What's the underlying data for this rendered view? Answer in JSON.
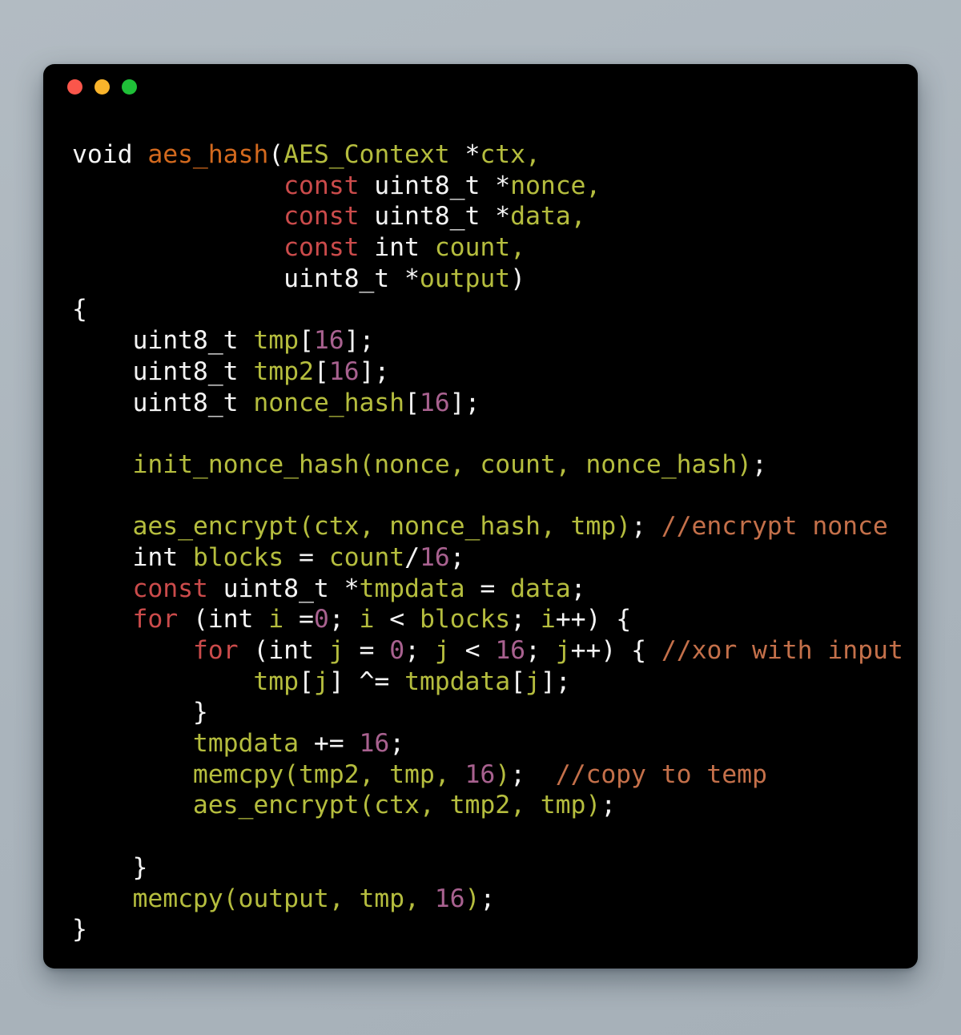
{
  "window": {
    "background_color": "#000000",
    "page_background_color": "#aeb7bf",
    "traffic_lights": [
      {
        "name": "close",
        "color": "#fa564b"
      },
      {
        "name": "minimize",
        "color": "#f9b42b"
      },
      {
        "name": "maximize",
        "color": "#1fc038"
      }
    ]
  },
  "theme": {
    "plain": "#f4f4f4",
    "keyword": "#cb4b4b",
    "function": "#d2691e",
    "identifier": "#b5bd3e",
    "number": "#a8618f",
    "comment": "#c4704a"
  },
  "code": {
    "language": "c",
    "plain_text": "void aes_hash(AES_Context *ctx,\n              const uint8_t *nonce,\n              const uint8_t *data,\n              const int count,\n              uint8_t *output)\n{\n    uint8_t tmp[16];\n    uint8_t tmp2[16];\n    uint8_t nonce_hash[16];\n\n    init_nonce_hash(nonce, count, nonce_hash);\n\n    aes_encrypt(ctx, nonce_hash, tmp); //encrypt nonce\n    int blocks = count/16;\n    const uint8_t *tmpdata = data;\n    for (int i =0; i < blocks; i++) {\n        for (int j = 0; j < 16; j++) { //xor with input\n            tmp[j] ^= tmpdata[j];\n        }\n        tmpdata += 16;\n        memcpy(tmp2, tmp, 16);  //copy to temp\n        aes_encrypt(ctx, tmp2, tmp);\n\n    }\n    memcpy(output, tmp, 16);\n}",
    "lines": [
      [
        {
          "t": "void ",
          "c": "plain"
        },
        {
          "t": "aes_hash",
          "c": "function"
        },
        {
          "t": "(",
          "c": "plain"
        },
        {
          "t": "AES_Context",
          "c": "identifier"
        },
        {
          "t": " *",
          "c": "plain"
        },
        {
          "t": "ctx",
          "c": "identifier"
        },
        {
          "t": ",",
          "c": "identifier"
        }
      ],
      [
        {
          "t": "              ",
          "c": "plain"
        },
        {
          "t": "const",
          "c": "keyword"
        },
        {
          "t": " uint8_t *",
          "c": "plain"
        },
        {
          "t": "nonce",
          "c": "identifier"
        },
        {
          "t": ",",
          "c": "identifier"
        }
      ],
      [
        {
          "t": "              ",
          "c": "plain"
        },
        {
          "t": "const",
          "c": "keyword"
        },
        {
          "t": " uint8_t *",
          "c": "plain"
        },
        {
          "t": "data",
          "c": "identifier"
        },
        {
          "t": ",",
          "c": "identifier"
        }
      ],
      [
        {
          "t": "              ",
          "c": "plain"
        },
        {
          "t": "const",
          "c": "keyword"
        },
        {
          "t": " int ",
          "c": "plain"
        },
        {
          "t": "count",
          "c": "identifier"
        },
        {
          "t": ",",
          "c": "identifier"
        }
      ],
      [
        {
          "t": "              uint8_t *",
          "c": "plain"
        },
        {
          "t": "output",
          "c": "identifier"
        },
        {
          "t": ")",
          "c": "plain"
        }
      ],
      [
        {
          "t": "{",
          "c": "plain"
        }
      ],
      [
        {
          "t": "    uint8_t ",
          "c": "plain"
        },
        {
          "t": "tmp",
          "c": "identifier"
        },
        {
          "t": "[",
          "c": "plain"
        },
        {
          "t": "16",
          "c": "number"
        },
        {
          "t": "];",
          "c": "plain"
        }
      ],
      [
        {
          "t": "    uint8_t ",
          "c": "plain"
        },
        {
          "t": "tmp2",
          "c": "identifier"
        },
        {
          "t": "[",
          "c": "plain"
        },
        {
          "t": "16",
          "c": "number"
        },
        {
          "t": "];",
          "c": "plain"
        }
      ],
      [
        {
          "t": "    uint8_t ",
          "c": "plain"
        },
        {
          "t": "nonce_hash",
          "c": "identifier"
        },
        {
          "t": "[",
          "c": "plain"
        },
        {
          "t": "16",
          "c": "number"
        },
        {
          "t": "];",
          "c": "plain"
        }
      ],
      [
        {
          "t": "",
          "c": "plain"
        }
      ],
      [
        {
          "t": "    ",
          "c": "plain"
        },
        {
          "t": "init_nonce_hash(nonce, count, nonce_hash)",
          "c": "identifier"
        },
        {
          "t": ";",
          "c": "plain"
        }
      ],
      [
        {
          "t": "",
          "c": "plain"
        }
      ],
      [
        {
          "t": "    ",
          "c": "plain"
        },
        {
          "t": "aes_encrypt(ctx, nonce_hash, tmp)",
          "c": "identifier"
        },
        {
          "t": "; ",
          "c": "plain"
        },
        {
          "t": "//encrypt nonce",
          "c": "comment"
        }
      ],
      [
        {
          "t": "    int ",
          "c": "plain"
        },
        {
          "t": "blocks",
          "c": "identifier"
        },
        {
          "t": " = ",
          "c": "plain"
        },
        {
          "t": "count",
          "c": "identifier"
        },
        {
          "t": "/",
          "c": "plain"
        },
        {
          "t": "16",
          "c": "number"
        },
        {
          "t": ";",
          "c": "plain"
        }
      ],
      [
        {
          "t": "    ",
          "c": "plain"
        },
        {
          "t": "const",
          "c": "keyword"
        },
        {
          "t": " uint8_t *",
          "c": "plain"
        },
        {
          "t": "tmpdata",
          "c": "identifier"
        },
        {
          "t": " = ",
          "c": "plain"
        },
        {
          "t": "data",
          "c": "identifier"
        },
        {
          "t": ";",
          "c": "plain"
        }
      ],
      [
        {
          "t": "    ",
          "c": "plain"
        },
        {
          "t": "for",
          "c": "keyword"
        },
        {
          "t": " (int ",
          "c": "plain"
        },
        {
          "t": "i",
          "c": "identifier"
        },
        {
          "t": " =",
          "c": "plain"
        },
        {
          "t": "0",
          "c": "number"
        },
        {
          "t": "; ",
          "c": "plain"
        },
        {
          "t": "i",
          "c": "identifier"
        },
        {
          "t": " < ",
          "c": "plain"
        },
        {
          "t": "blocks",
          "c": "identifier"
        },
        {
          "t": "; ",
          "c": "plain"
        },
        {
          "t": "i",
          "c": "identifier"
        },
        {
          "t": "++) {",
          "c": "plain"
        }
      ],
      [
        {
          "t": "        ",
          "c": "plain"
        },
        {
          "t": "for",
          "c": "keyword"
        },
        {
          "t": " (int ",
          "c": "plain"
        },
        {
          "t": "j",
          "c": "identifier"
        },
        {
          "t": " = ",
          "c": "plain"
        },
        {
          "t": "0",
          "c": "number"
        },
        {
          "t": "; ",
          "c": "plain"
        },
        {
          "t": "j",
          "c": "identifier"
        },
        {
          "t": " < ",
          "c": "plain"
        },
        {
          "t": "16",
          "c": "number"
        },
        {
          "t": "; ",
          "c": "plain"
        },
        {
          "t": "j",
          "c": "identifier"
        },
        {
          "t": "++) { ",
          "c": "plain"
        },
        {
          "t": "//xor with input",
          "c": "comment"
        }
      ],
      [
        {
          "t": "            ",
          "c": "plain"
        },
        {
          "t": "tmp",
          "c": "identifier"
        },
        {
          "t": "[",
          "c": "plain"
        },
        {
          "t": "j",
          "c": "identifier"
        },
        {
          "t": "] ^= ",
          "c": "plain"
        },
        {
          "t": "tmpdata",
          "c": "identifier"
        },
        {
          "t": "[",
          "c": "plain"
        },
        {
          "t": "j",
          "c": "identifier"
        },
        {
          "t": "];",
          "c": "plain"
        }
      ],
      [
        {
          "t": "        }",
          "c": "plain"
        }
      ],
      [
        {
          "t": "        ",
          "c": "plain"
        },
        {
          "t": "tmpdata",
          "c": "identifier"
        },
        {
          "t": " += ",
          "c": "plain"
        },
        {
          "t": "16",
          "c": "number"
        },
        {
          "t": ";",
          "c": "plain"
        }
      ],
      [
        {
          "t": "        ",
          "c": "plain"
        },
        {
          "t": "memcpy(tmp2, tmp, ",
          "c": "identifier"
        },
        {
          "t": "16",
          "c": "number"
        },
        {
          "t": ")",
          "c": "identifier"
        },
        {
          "t": ";  ",
          "c": "plain"
        },
        {
          "t": "//copy to temp",
          "c": "comment"
        }
      ],
      [
        {
          "t": "        ",
          "c": "plain"
        },
        {
          "t": "aes_encrypt(ctx, tmp2, tmp)",
          "c": "identifier"
        },
        {
          "t": ";",
          "c": "plain"
        }
      ],
      [
        {
          "t": "",
          "c": "plain"
        }
      ],
      [
        {
          "t": "    }",
          "c": "plain"
        }
      ],
      [
        {
          "t": "    ",
          "c": "plain"
        },
        {
          "t": "memcpy(output, tmp, ",
          "c": "identifier"
        },
        {
          "t": "16",
          "c": "number"
        },
        {
          "t": ")",
          "c": "identifier"
        },
        {
          "t": ";",
          "c": "plain"
        }
      ],
      [
        {
          "t": "}",
          "c": "plain"
        }
      ]
    ]
  }
}
